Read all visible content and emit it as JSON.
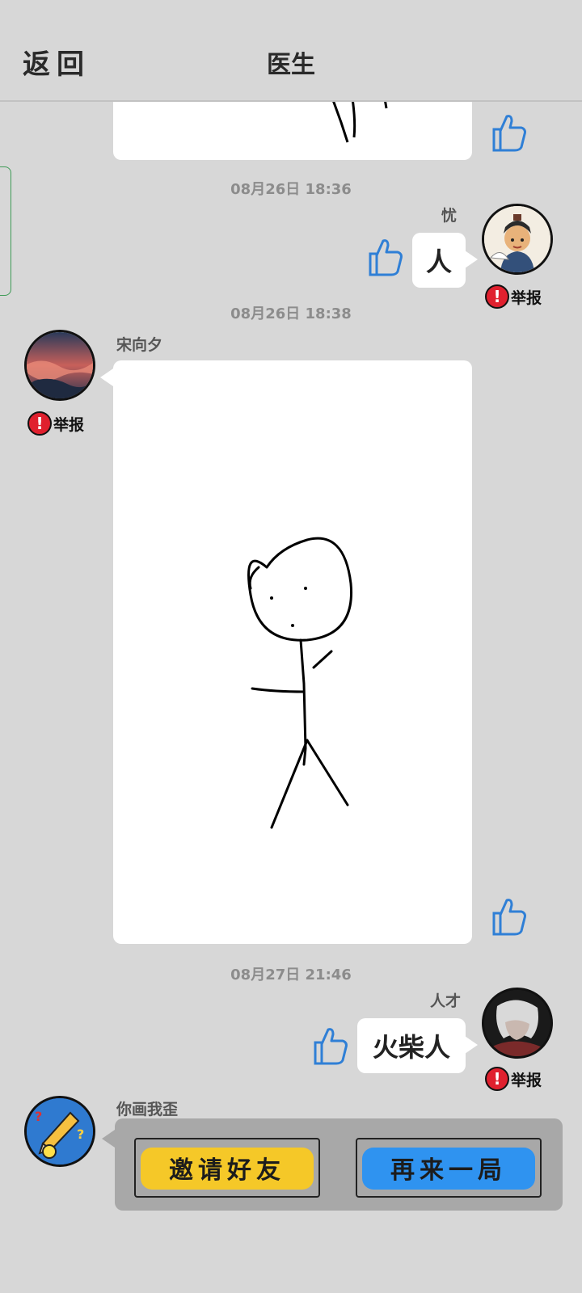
{
  "header": {
    "back_label": "返回",
    "title": "医生"
  },
  "messages": [
    {
      "timestamp": "08月26日  18:36",
      "sender": "忧",
      "text": "人",
      "report_label": "举报"
    },
    {
      "timestamp": "08月26日  18:38",
      "sender": "宋向夕",
      "content": "drawing",
      "report_label": "举报"
    },
    {
      "timestamp": "08月27日  21:46",
      "sender": "人才",
      "text": "火柴人",
      "report_label": "举报"
    },
    {
      "sender": "你画我歪"
    }
  ],
  "game_card": {
    "invite_label": "邀请好友",
    "replay_label": "再来一局"
  },
  "colors": {
    "background": "#d7d7d7",
    "like_blue": "#2f7fd6",
    "report_red": "#e0202e",
    "invite_yellow": "#f5c828",
    "replay_blue": "#2f93f0"
  },
  "icons": [
    "thumbs-up-icon",
    "report-alert-icon"
  ]
}
